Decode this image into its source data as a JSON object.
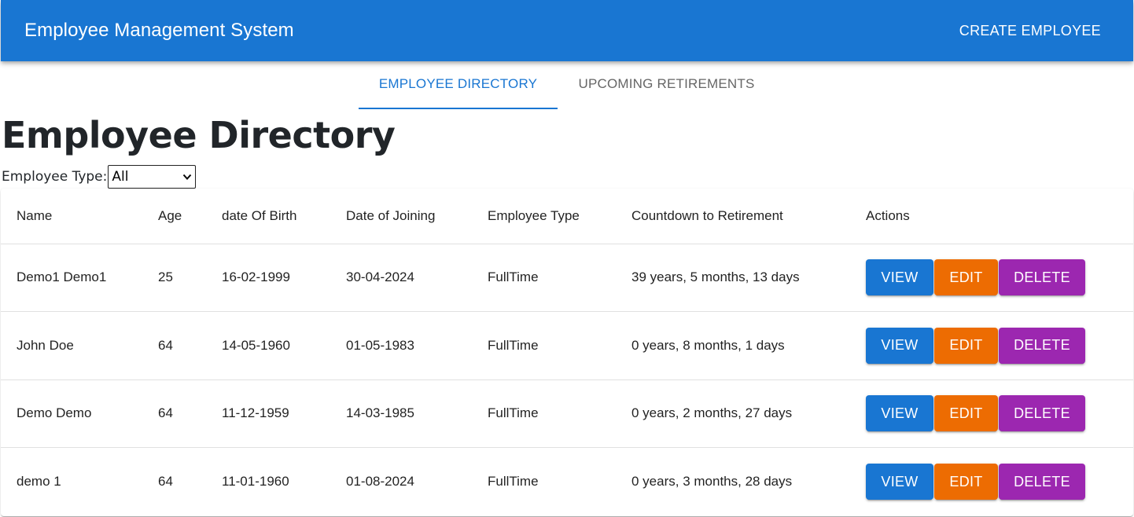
{
  "header": {
    "title": "Employee Management System",
    "create_label": "CREATE EMPLOYEE"
  },
  "tabs": [
    {
      "label": "EMPLOYEE DIRECTORY",
      "active": true
    },
    {
      "label": "UPCOMING RETIREMENTS",
      "active": false
    }
  ],
  "page": {
    "title": "Employee Directory",
    "filter_label": "Employee Type:",
    "filter_value": "All"
  },
  "table": {
    "columns": [
      "Name",
      "Age",
      "date Of Birth",
      "Date of Joining",
      "Employee Type",
      "Countdown to Retirement",
      "Actions"
    ],
    "rows": [
      {
        "name": "Demo1 Demo1",
        "age": "25",
        "dob": "16-02-1999",
        "doj": "30-04-2024",
        "type": "FullTime",
        "countdown": "39 years, 5 months, 13 days"
      },
      {
        "name": "John Doe",
        "age": "64",
        "dob": "14-05-1960",
        "doj": "01-05-1983",
        "type": "FullTime",
        "countdown": "0 years, 8 months, 1 days"
      },
      {
        "name": "Demo Demo",
        "age": "64",
        "dob": "11-12-1959",
        "doj": "14-03-1985",
        "type": "FullTime",
        "countdown": "0 years, 2 months, 27 days"
      },
      {
        "name": "demo 1",
        "age": "64",
        "dob": "11-01-1960",
        "doj": "01-08-2024",
        "type": "FullTime",
        "countdown": "0 years, 3 months, 28 days"
      }
    ],
    "action_labels": {
      "view": "VIEW",
      "edit": "EDIT",
      "delete": "DELETE"
    }
  },
  "colors": {
    "primary": "#1976d2",
    "edit": "#ed6c02",
    "delete": "#9c27b0"
  },
  "icons": {
    "select_chevron": "chevron-down-icon"
  }
}
